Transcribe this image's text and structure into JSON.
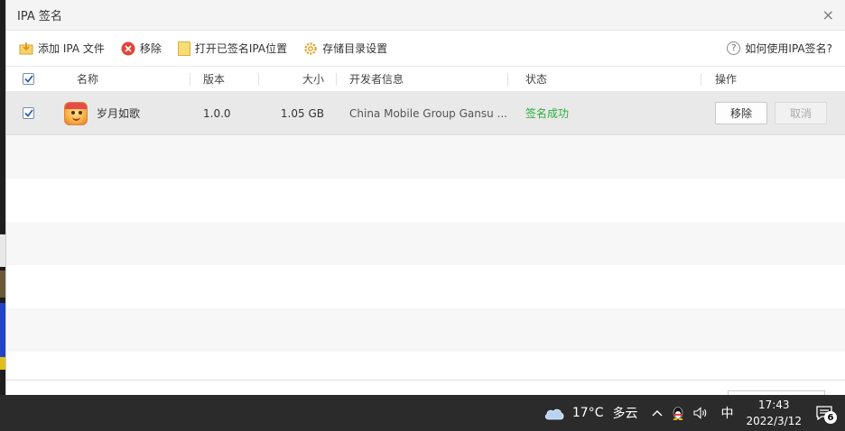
{
  "window": {
    "title": "IPA 签名",
    "close_glyph": "×"
  },
  "toolbar": {
    "add_label": "添加 IPA 文件",
    "remove_label": "移除",
    "open_location_label": "打开已签名IPA位置",
    "storage_settings_label": "存储目录设置",
    "help_label": "如何使用IPA签名?"
  },
  "table": {
    "headers": {
      "name": "名称",
      "version": "版本",
      "size": "大小",
      "developer": "开发者信息",
      "status": "状态",
      "actions": "操作"
    },
    "rows": [
      {
        "checked": true,
        "name": "岁月如歌",
        "version": "1.0.0",
        "size": "1.05 GB",
        "developer": "China Mobile Group Gansu ...",
        "status": "签名成功",
        "remove_label": "移除",
        "cancel_label": "取消"
      }
    ]
  },
  "taskbar": {
    "temperature": "17°C",
    "weather": "多云",
    "ime": "中",
    "time": "17:43",
    "date": "2022/3/12",
    "notification_count": "6"
  },
  "colors": {
    "status_success": "#2bad3c",
    "selected_row": "#e9e9e9",
    "taskbar": "#2b2b2b"
  }
}
